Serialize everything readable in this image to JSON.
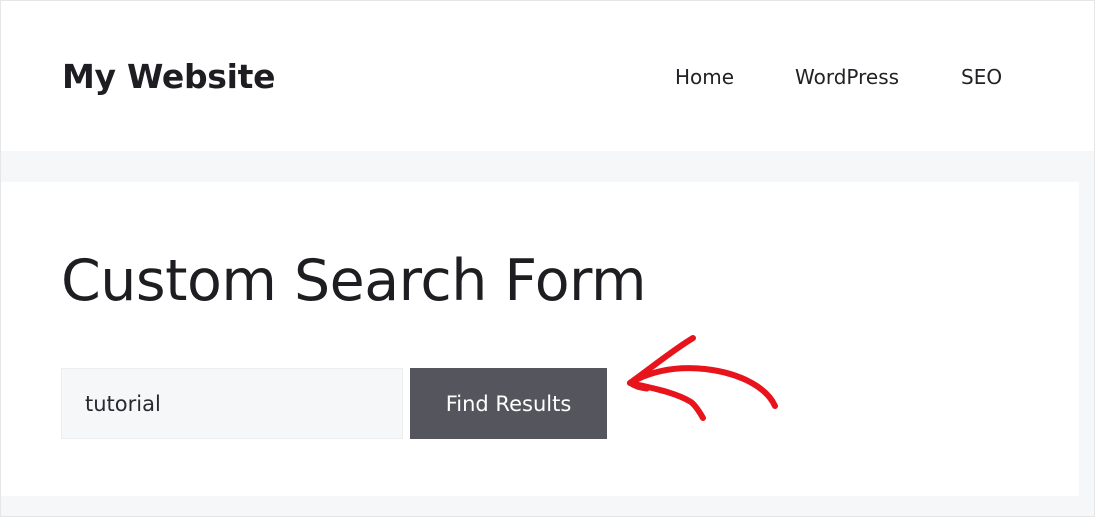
{
  "header": {
    "site_title": "My Website",
    "nav": [
      {
        "label": "Home"
      },
      {
        "label": "WordPress"
      },
      {
        "label": "SEO"
      }
    ]
  },
  "main": {
    "title": "Custom Search Form",
    "search": {
      "value": "tutorial",
      "placeholder": "",
      "button_label": "Find Results"
    }
  },
  "annotation": {
    "icon": "red-hand-drawn-arrow-icon",
    "color": "#e8141c"
  },
  "colors": {
    "button": "#55555e",
    "input_bg": "#f6f7f8",
    "page_bg": "#f6f7f8",
    "text": "#1e1e22"
  }
}
